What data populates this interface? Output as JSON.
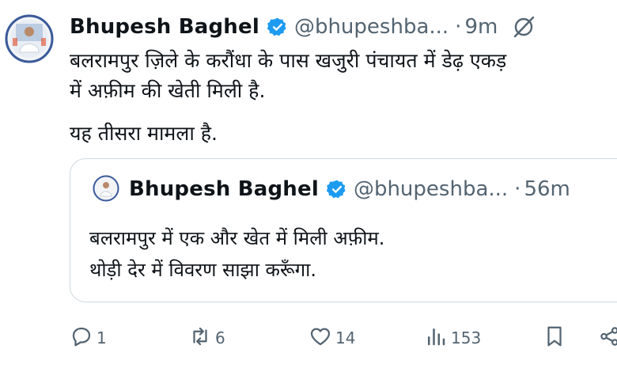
{
  "tweet": {
    "author_name": "Bhupesh Baghel",
    "handle": "@bhupeshba...",
    "separator": "·",
    "time": "9m",
    "text_lines": [
      "बलरामपुर ज़िले के करौंधा के पास खजुरी पंचायत में डेढ़ एकड़",
      "में अफ़ीम की खेती मिली है.",
      "यह तीसरा मामला है."
    ]
  },
  "quoted_tweet": {
    "author_name": "Bhupesh Baghel",
    "handle": "@bhupeshba...",
    "separator": "·",
    "time": "56m",
    "text_lines": [
      "बलरामपुर में एक और खेत में मिली अफ़ीम.",
      "थोड़ी देर में विवरण साझा करूँगा."
    ]
  },
  "actions": {
    "replies": "1",
    "reposts": "6",
    "likes": "14",
    "views": "153"
  },
  "icons": {
    "verified": "verified-badge-icon",
    "grok": "grok-icon",
    "reply": "reply-icon",
    "repost": "repost-icon",
    "like": "like-icon",
    "views": "views-icon",
    "bookmark": "bookmark-icon",
    "share": "share-icon"
  },
  "colors": {
    "verified": "#1d9bf0",
    "text": "#0f1419",
    "muted": "#536471",
    "border": "#cfd9de"
  }
}
